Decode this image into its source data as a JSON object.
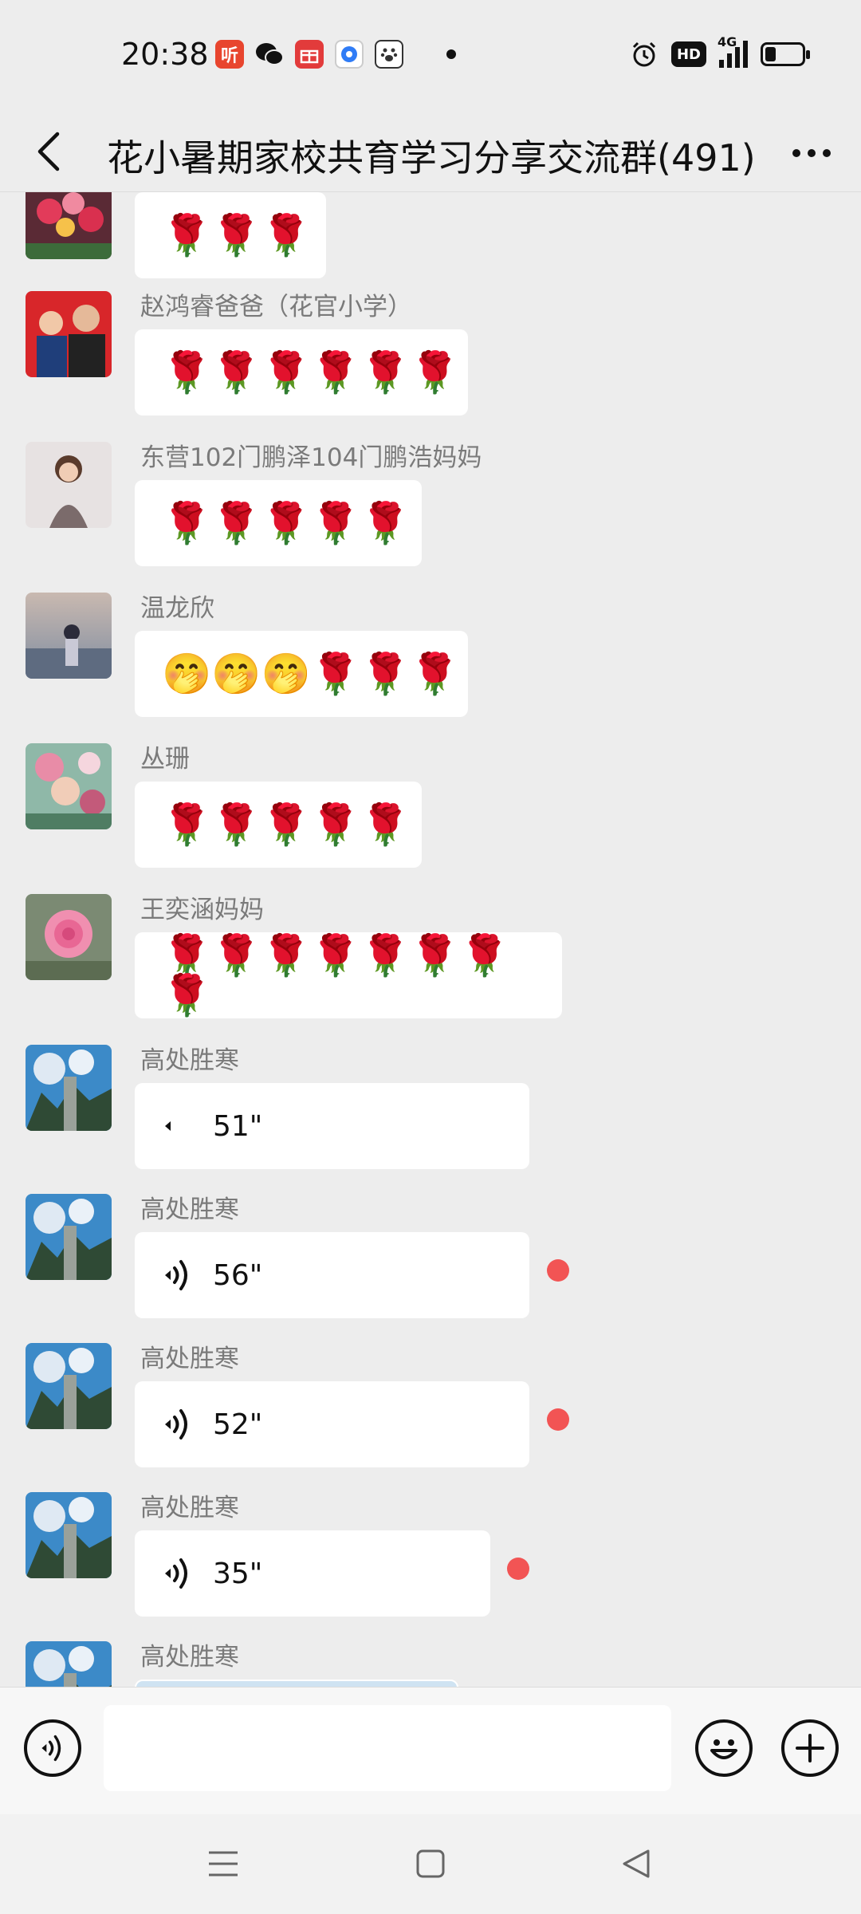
{
  "status_bar": {
    "time": "20:38",
    "apps": [
      {
        "icon": "ting-app-icon",
        "glyph": "听",
        "color": "#e8452e"
      },
      {
        "icon": "wechat-icon",
        "glyph": "✦",
        "color": "#111111"
      },
      {
        "icon": "gift-app-icon",
        "glyph": "❖",
        "color": "#e23b3b"
      },
      {
        "icon": "browser-app-icon",
        "glyph": "◉",
        "color": "#2f7cf6"
      },
      {
        "icon": "baidu-app-icon",
        "glyph": "✿",
        "color": "#333333"
      }
    ],
    "hd_label": "HD",
    "network_label": "4G",
    "battery_level": 0.3
  },
  "header": {
    "title": "花小暑期家校共育学习分享交流群(491)"
  },
  "messages": [
    {
      "sender": "",
      "content": "🌹🌹🌹",
      "type": "emoji"
    },
    {
      "sender": "赵鸿睿爸爸（花官小学）",
      "content": "🌹🌹🌹🌹🌹🌹",
      "type": "emoji"
    },
    {
      "sender": "东营102门鹏泽104门鹏浩妈妈",
      "content": "🌹🌹🌹🌹🌹",
      "type": "emoji"
    },
    {
      "sender": "温龙欣",
      "content": "🤭🤭🤭🌹🌹🌹",
      "type": "emoji"
    },
    {
      "sender": "丛珊",
      "content": "🌹🌹🌹🌹🌹",
      "type": "emoji"
    },
    {
      "sender": "王奕涵妈妈",
      "content": "🌹🌹🌹🌹🌹🌹🌹🌹",
      "type": "emoji"
    },
    {
      "sender": "高处胜寒",
      "duration": "51\"",
      "type": "voice",
      "playing": true,
      "unread": false
    },
    {
      "sender": "高处胜寒",
      "duration": "56\"",
      "type": "voice",
      "playing": false,
      "unread": true
    },
    {
      "sender": "高处胜寒",
      "duration": "52\"",
      "type": "voice",
      "playing": false,
      "unread": true
    },
    {
      "sender": "高处胜寒",
      "duration": "35\"",
      "type": "voice",
      "playing": false,
      "unread": true
    },
    {
      "sender": "高处胜寒",
      "content": "",
      "type": "image"
    }
  ],
  "input_bar": {
    "placeholder": "",
    "value": ""
  },
  "colors": {
    "background": "#ededed",
    "bubble": "#ffffff",
    "sender_name": "#7a7a7a",
    "unread_dot": "#f25454"
  }
}
